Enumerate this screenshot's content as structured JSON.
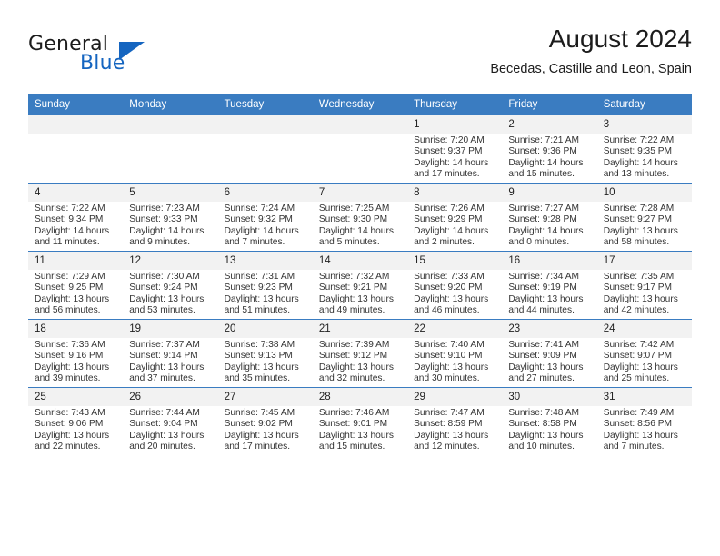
{
  "brand": {
    "name_part1": "General",
    "name_part2": "Blue",
    "triangle_color": "#1565c0"
  },
  "header": {
    "title": "August 2024",
    "subtitle": "Becedas, Castille and Leon, Spain"
  },
  "theme": {
    "header_bg": "#3a7cc1",
    "daynum_bg": "#f2f2f2",
    "text": "#222222"
  },
  "weekday_headers": [
    "Sunday",
    "Monday",
    "Tuesday",
    "Wednesday",
    "Thursday",
    "Friday",
    "Saturday"
  ],
  "labels": {
    "sunrise": "Sunrise:",
    "sunset": "Sunset:",
    "daylight": "Daylight:"
  },
  "weeks": [
    [
      {
        "day": "",
        "empty": true
      },
      {
        "day": "",
        "empty": true
      },
      {
        "day": "",
        "empty": true
      },
      {
        "day": "",
        "empty": true
      },
      {
        "day": "1",
        "sunrise": "Sunrise: 7:20 AM",
        "sunset": "Sunset: 9:37 PM",
        "daylight_line1": "Daylight: 14 hours",
        "daylight_line2": "and 17 minutes."
      },
      {
        "day": "2",
        "sunrise": "Sunrise: 7:21 AM",
        "sunset": "Sunset: 9:36 PM",
        "daylight_line1": "Daylight: 14 hours",
        "daylight_line2": "and 15 minutes."
      },
      {
        "day": "3",
        "sunrise": "Sunrise: 7:22 AM",
        "sunset": "Sunset: 9:35 PM",
        "daylight_line1": "Daylight: 14 hours",
        "daylight_line2": "and 13 minutes."
      }
    ],
    [
      {
        "day": "4",
        "sunrise": "Sunrise: 7:22 AM",
        "sunset": "Sunset: 9:34 PM",
        "daylight_line1": "Daylight: 14 hours",
        "daylight_line2": "and 11 minutes."
      },
      {
        "day": "5",
        "sunrise": "Sunrise: 7:23 AM",
        "sunset": "Sunset: 9:33 PM",
        "daylight_line1": "Daylight: 14 hours",
        "daylight_line2": "and 9 minutes."
      },
      {
        "day": "6",
        "sunrise": "Sunrise: 7:24 AM",
        "sunset": "Sunset: 9:32 PM",
        "daylight_line1": "Daylight: 14 hours",
        "daylight_line2": "and 7 minutes."
      },
      {
        "day": "7",
        "sunrise": "Sunrise: 7:25 AM",
        "sunset": "Sunset: 9:30 PM",
        "daylight_line1": "Daylight: 14 hours",
        "daylight_line2": "and 5 minutes."
      },
      {
        "day": "8",
        "sunrise": "Sunrise: 7:26 AM",
        "sunset": "Sunset: 9:29 PM",
        "daylight_line1": "Daylight: 14 hours",
        "daylight_line2": "and 2 minutes."
      },
      {
        "day": "9",
        "sunrise": "Sunrise: 7:27 AM",
        "sunset": "Sunset: 9:28 PM",
        "daylight_line1": "Daylight: 14 hours",
        "daylight_line2": "and 0 minutes."
      },
      {
        "day": "10",
        "sunrise": "Sunrise: 7:28 AM",
        "sunset": "Sunset: 9:27 PM",
        "daylight_line1": "Daylight: 13 hours",
        "daylight_line2": "and 58 minutes."
      }
    ],
    [
      {
        "day": "11",
        "sunrise": "Sunrise: 7:29 AM",
        "sunset": "Sunset: 9:25 PM",
        "daylight_line1": "Daylight: 13 hours",
        "daylight_line2": "and 56 minutes."
      },
      {
        "day": "12",
        "sunrise": "Sunrise: 7:30 AM",
        "sunset": "Sunset: 9:24 PM",
        "daylight_line1": "Daylight: 13 hours",
        "daylight_line2": "and 53 minutes."
      },
      {
        "day": "13",
        "sunrise": "Sunrise: 7:31 AM",
        "sunset": "Sunset: 9:23 PM",
        "daylight_line1": "Daylight: 13 hours",
        "daylight_line2": "and 51 minutes."
      },
      {
        "day": "14",
        "sunrise": "Sunrise: 7:32 AM",
        "sunset": "Sunset: 9:21 PM",
        "daylight_line1": "Daylight: 13 hours",
        "daylight_line2": "and 49 minutes."
      },
      {
        "day": "15",
        "sunrise": "Sunrise: 7:33 AM",
        "sunset": "Sunset: 9:20 PM",
        "daylight_line1": "Daylight: 13 hours",
        "daylight_line2": "and 46 minutes."
      },
      {
        "day": "16",
        "sunrise": "Sunrise: 7:34 AM",
        "sunset": "Sunset: 9:19 PM",
        "daylight_line1": "Daylight: 13 hours",
        "daylight_line2": "and 44 minutes."
      },
      {
        "day": "17",
        "sunrise": "Sunrise: 7:35 AM",
        "sunset": "Sunset: 9:17 PM",
        "daylight_line1": "Daylight: 13 hours",
        "daylight_line2": "and 42 minutes."
      }
    ],
    [
      {
        "day": "18",
        "sunrise": "Sunrise: 7:36 AM",
        "sunset": "Sunset: 9:16 PM",
        "daylight_line1": "Daylight: 13 hours",
        "daylight_line2": "and 39 minutes."
      },
      {
        "day": "19",
        "sunrise": "Sunrise: 7:37 AM",
        "sunset": "Sunset: 9:14 PM",
        "daylight_line1": "Daylight: 13 hours",
        "daylight_line2": "and 37 minutes."
      },
      {
        "day": "20",
        "sunrise": "Sunrise: 7:38 AM",
        "sunset": "Sunset: 9:13 PM",
        "daylight_line1": "Daylight: 13 hours",
        "daylight_line2": "and 35 minutes."
      },
      {
        "day": "21",
        "sunrise": "Sunrise: 7:39 AM",
        "sunset": "Sunset: 9:12 PM",
        "daylight_line1": "Daylight: 13 hours",
        "daylight_line2": "and 32 minutes."
      },
      {
        "day": "22",
        "sunrise": "Sunrise: 7:40 AM",
        "sunset": "Sunset: 9:10 PM",
        "daylight_line1": "Daylight: 13 hours",
        "daylight_line2": "and 30 minutes."
      },
      {
        "day": "23",
        "sunrise": "Sunrise: 7:41 AM",
        "sunset": "Sunset: 9:09 PM",
        "daylight_line1": "Daylight: 13 hours",
        "daylight_line2": "and 27 minutes."
      },
      {
        "day": "24",
        "sunrise": "Sunrise: 7:42 AM",
        "sunset": "Sunset: 9:07 PM",
        "daylight_line1": "Daylight: 13 hours",
        "daylight_line2": "and 25 minutes."
      }
    ],
    [
      {
        "day": "25",
        "sunrise": "Sunrise: 7:43 AM",
        "sunset": "Sunset: 9:06 PM",
        "daylight_line1": "Daylight: 13 hours",
        "daylight_line2": "and 22 minutes."
      },
      {
        "day": "26",
        "sunrise": "Sunrise: 7:44 AM",
        "sunset": "Sunset: 9:04 PM",
        "daylight_line1": "Daylight: 13 hours",
        "daylight_line2": "and 20 minutes."
      },
      {
        "day": "27",
        "sunrise": "Sunrise: 7:45 AM",
        "sunset": "Sunset: 9:02 PM",
        "daylight_line1": "Daylight: 13 hours",
        "daylight_line2": "and 17 minutes."
      },
      {
        "day": "28",
        "sunrise": "Sunrise: 7:46 AM",
        "sunset": "Sunset: 9:01 PM",
        "daylight_line1": "Daylight: 13 hours",
        "daylight_line2": "and 15 minutes."
      },
      {
        "day": "29",
        "sunrise": "Sunrise: 7:47 AM",
        "sunset": "Sunset: 8:59 PM",
        "daylight_line1": "Daylight: 13 hours",
        "daylight_line2": "and 12 minutes."
      },
      {
        "day": "30",
        "sunrise": "Sunrise: 7:48 AM",
        "sunset": "Sunset: 8:58 PM",
        "daylight_line1": "Daylight: 13 hours",
        "daylight_line2": "and 10 minutes."
      },
      {
        "day": "31",
        "sunrise": "Sunrise: 7:49 AM",
        "sunset": "Sunset: 8:56 PM",
        "daylight_line1": "Daylight: 13 hours",
        "daylight_line2": "and 7 minutes."
      }
    ]
  ]
}
